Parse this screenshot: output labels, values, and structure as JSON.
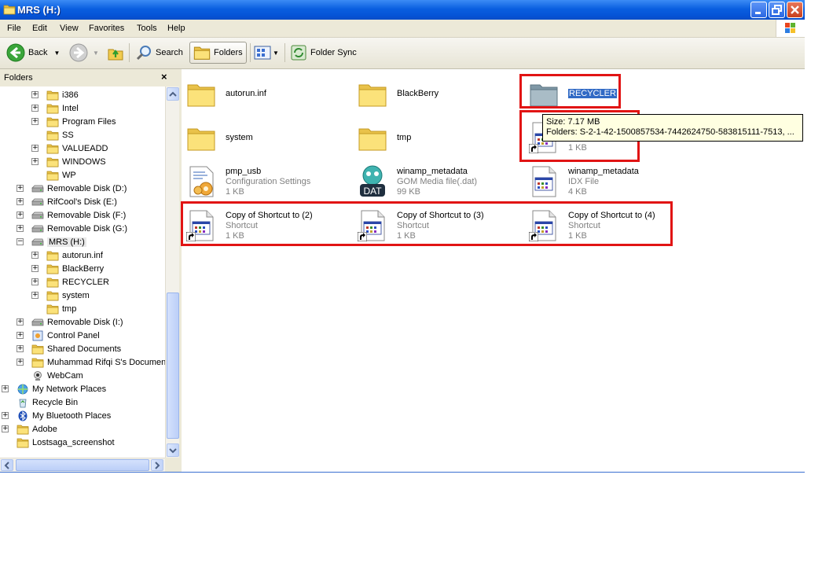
{
  "window": {
    "title": "MRS (H:)"
  },
  "menu": [
    "File",
    "Edit",
    "View",
    "Favorites",
    "Tools",
    "Help"
  ],
  "toolbar": {
    "back": "Back",
    "search": "Search",
    "folders": "Folders",
    "folder_sync": "Folder Sync"
  },
  "folders_pane": {
    "title": "Folders",
    "close": "×",
    "tree": [
      {
        "label": "i386",
        "expander": "+",
        "icon": "folder-icon"
      },
      {
        "label": "Intel",
        "expander": "+",
        "icon": "folder-icon"
      },
      {
        "label": "Program Files",
        "expander": "+",
        "icon": "folder-icon"
      },
      {
        "label": "SS",
        "expander": "",
        "icon": "folder-icon"
      },
      {
        "label": "VALUEADD",
        "expander": "+",
        "icon": "folder-icon"
      },
      {
        "label": "WINDOWS",
        "expander": "+",
        "icon": "folder-icon"
      },
      {
        "label": "WP",
        "expander": "",
        "icon": "folder-icon"
      },
      {
        "label": "Removable Disk (D:)",
        "expander": "+",
        "icon": "drive-icon"
      },
      {
        "label": "RifCool's Disk (E:)",
        "expander": "+",
        "icon": "drive-icon"
      },
      {
        "label": "Removable Disk (F:)",
        "expander": "+",
        "icon": "drive-icon"
      },
      {
        "label": "Removable Disk (G:)",
        "expander": "+",
        "icon": "drive-icon"
      },
      {
        "label": "MRS (H:)",
        "expander": "−",
        "icon": "drive-icon"
      },
      {
        "label": "autorun.inf",
        "expander": "+",
        "icon": "folder-icon"
      },
      {
        "label": "BlackBerry",
        "expander": "+",
        "icon": "folder-icon"
      },
      {
        "label": "RECYCLER",
        "expander": "+",
        "icon": "folder-icon"
      },
      {
        "label": "system",
        "expander": "+",
        "icon": "folder-icon"
      },
      {
        "label": "tmp",
        "expander": "",
        "icon": "folder-icon"
      },
      {
        "label": "Removable Disk (I:)",
        "expander": "+",
        "icon": "drive-icon"
      },
      {
        "label": "Control Panel",
        "expander": "+",
        "icon": "control-panel-icon"
      },
      {
        "label": "Shared Documents",
        "expander": "+",
        "icon": "folder-icon"
      },
      {
        "label": "Muhammad Rifqi S's Documents",
        "expander": "+",
        "icon": "folder-icon"
      },
      {
        "label": "WebCam",
        "expander": "",
        "icon": "webcam-icon"
      },
      {
        "label": "My Network Places",
        "expander": "+",
        "icon": "network-icon"
      },
      {
        "label": "Recycle Bin",
        "expander": "",
        "icon": "recycle-bin-icon"
      },
      {
        "label": "My Bluetooth Places",
        "expander": "+",
        "icon": "bluetooth-icon"
      },
      {
        "label": "Adobe",
        "expander": "+",
        "icon": "folder-icon"
      },
      {
        "label": "Lostsaga_screenshot",
        "expander": "",
        "icon": "folder-icon"
      }
    ]
  },
  "files": [
    {
      "name": "autorun.inf",
      "type": "",
      "size": "",
      "icon": "folder-icon"
    },
    {
      "name": "BlackBerry",
      "type": "",
      "size": "",
      "icon": "folder-icon"
    },
    {
      "name": "RECYCLER",
      "type": "",
      "size": "",
      "icon": "grey-folder-icon",
      "selected": true
    },
    {
      "name": "system",
      "type": "",
      "size": "",
      "icon": "folder-icon"
    },
    {
      "name": "tmp",
      "type": "",
      "size": "",
      "icon": "folder-icon"
    },
    {
      "name": "",
      "type": "",
      "size": "1 KB",
      "icon": "shortcut-icon"
    },
    {
      "name": "pmp_usb",
      "type": "Configuration Settings",
      "size": "1 KB",
      "icon": "config-settings-icon"
    },
    {
      "name": "winamp_metadata",
      "type": "GOM Media file(.dat)",
      "size": "99 KB",
      "icon": "dat-file-icon"
    },
    {
      "name": "winamp_metadata",
      "type": "IDX File",
      "size": "4 KB",
      "icon": "generic-file-icon"
    },
    {
      "name": "Copy of Shortcut to (2)",
      "type": "Shortcut",
      "size": "1 KB",
      "icon": "shortcut-icon"
    },
    {
      "name": "Copy of Shortcut to (3)",
      "type": "Shortcut",
      "size": "1 KB",
      "icon": "shortcut-icon"
    },
    {
      "name": "Copy of Shortcut to (4)",
      "type": "Shortcut",
      "size": "1 KB",
      "icon": "shortcut-icon"
    }
  ],
  "tooltip": {
    "line1": "Size: 7.17 MB",
    "line2": "Folders: S-2-1-42-1500857534-7442624750-583815111-7513, ..."
  },
  "colors": {
    "titlebar": "#0a5fe0",
    "selection": "#316ac5",
    "highlight_box": "#e11414",
    "tooltip_bg": "#ffffe1"
  }
}
